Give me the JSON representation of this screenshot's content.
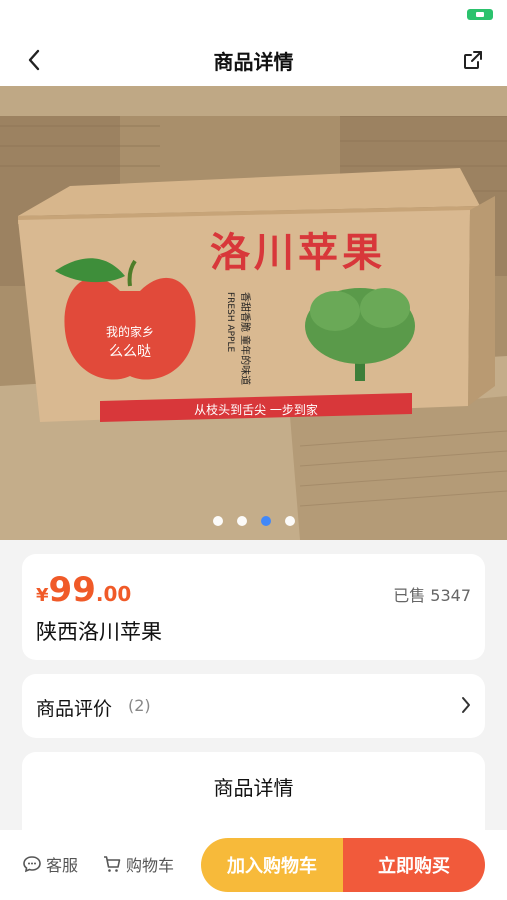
{
  "nav": {
    "title": "商品详情"
  },
  "gallery": {
    "box_title": "洛川苹果",
    "box_slogan": "从枝头到舌尖 一步到家",
    "apple_text_1": "我的家乡",
    "apple_text_2": "么么哒",
    "fresh_text": "FRESH APPLE",
    "vertical_text": "香甜香脆 童年的味道",
    "image_count": 4,
    "active_index": 2
  },
  "product": {
    "currency": "¥",
    "price_int": "99",
    "price_dec": ".00",
    "sold": "已售 5347",
    "name": "陕西洛川苹果"
  },
  "reviews": {
    "label": "商品评价",
    "count": "(2)"
  },
  "details": {
    "title": "商品详情"
  },
  "bottom": {
    "service": "客服",
    "cart": "购物车",
    "add_to_cart": "加入购物车",
    "buy_now": "立即购买"
  },
  "colors": {
    "accent": "#f05a28",
    "add_cart_bg": "#f7ba3a",
    "buy_bg": "#f15a3b",
    "active_dot": "#3a86ff"
  }
}
